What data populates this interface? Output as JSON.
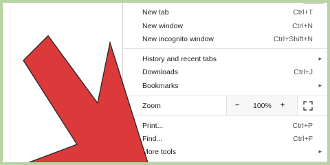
{
  "accent": {
    "arrow": "#dc3a3a",
    "frame": "#b8d3a4"
  },
  "menu": {
    "group1": [
      {
        "label": "New tab",
        "shortcut": "Ctrl+T"
      },
      {
        "label": "New window",
        "shortcut": "Ctrl+N"
      },
      {
        "label": "New incognito window",
        "shortcut": "Ctrl+Shift+N"
      }
    ],
    "group2": [
      {
        "label": "History and recent tabs",
        "shortcut": ""
      },
      {
        "label": "Downloads",
        "shortcut": "Ctrl+J"
      },
      {
        "label": "Bookmarks",
        "shortcut": ""
      }
    ],
    "zoom": {
      "label": "Zoom",
      "minus": "−",
      "value": "100%",
      "plus": "+"
    },
    "group3": [
      {
        "label": "Print...",
        "shortcut": "Ctrl+P"
      },
      {
        "label": "Find...",
        "shortcut": "Ctrl+F"
      },
      {
        "label": "More tools",
        "shortcut": ""
      }
    ]
  }
}
